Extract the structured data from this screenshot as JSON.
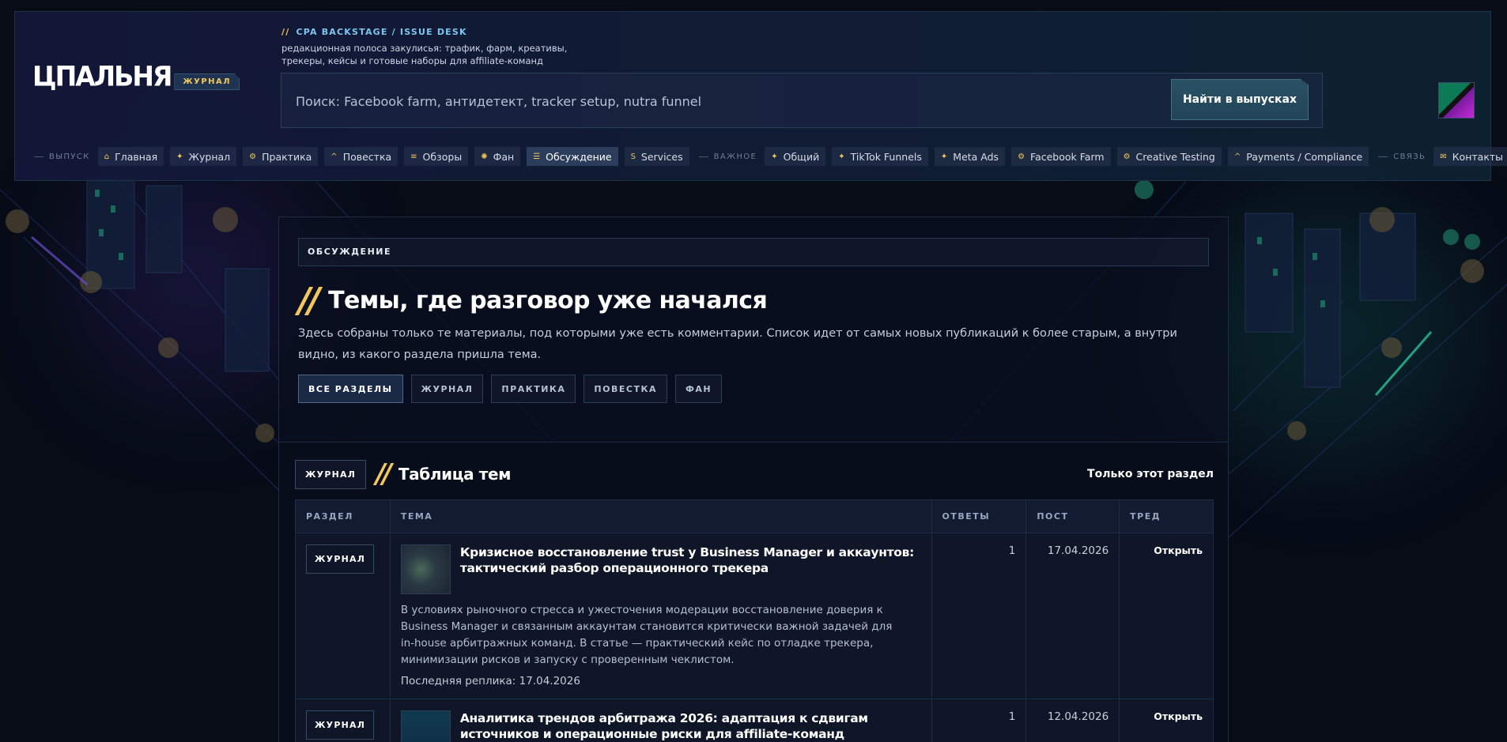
{
  "brand": {
    "logo": "ЦПАЛЬНЯ",
    "badge": "ЖУРНАЛ"
  },
  "header": {
    "kicker_slash": "//",
    "kicker": "CPA BACKSTAGE / ISSUE DESK",
    "tagline": "редакционная полоса закулисья: трафик, фарм, креативы, трекеры, кейсы и готовые наборы для affiliate-команд"
  },
  "search": {
    "placeholder": "Поиск: Facebook farm, антидетект, tracker setup, nutra funnel",
    "button": "Найти в выпусках"
  },
  "nav": {
    "group_issue": "ВЫПУСК",
    "group_important": "ВАЖНОЕ",
    "group_contact": "СВЯЗЬ",
    "items": [
      {
        "label": "Главная",
        "icon": "⌂"
      },
      {
        "label": "Журнал",
        "icon": "✦"
      },
      {
        "label": "Практика",
        "icon": "⚙"
      },
      {
        "label": "Повестка",
        "icon": "^"
      },
      {
        "label": "Обзоры",
        "icon": "≡"
      },
      {
        "label": "Фан",
        "icon": "✺"
      },
      {
        "label": "Обсуждение",
        "icon": "☰"
      },
      {
        "label": "Services",
        "icon": "S"
      },
      {
        "label": "Общий",
        "icon": "✦"
      },
      {
        "label": "TikTok Funnels",
        "icon": "✦"
      },
      {
        "label": "Meta Ads",
        "icon": "✦"
      },
      {
        "label": "Facebook Farm",
        "icon": "⚙"
      },
      {
        "label": "Creative Testing",
        "icon": "⚙"
      },
      {
        "label": "Payments / Compliance",
        "icon": "^"
      },
      {
        "label": "Контакты",
        "icon": "✉"
      }
    ]
  },
  "discussion": {
    "section_label": "ОБСУЖДЕНИЕ",
    "slash": "//",
    "title": "Темы, где разговор уже начался",
    "lead": "Здесь собраны только те материалы, под которыми уже есть комментарии. Список идет от самых новых публикаций к более старым, а внутри видно, из какого раздела пришла тема.",
    "filters": [
      "ВСЕ РАЗДЕЛЫ",
      "ЖУРНАЛ",
      "ПРАКТИКА",
      "ПОВЕСТКА",
      "ФАН"
    ]
  },
  "table_section": {
    "tag": "ЖУРНАЛ",
    "slash": "//",
    "title": "Таблица тем",
    "only_link": "Только этот раздел",
    "headers": [
      "РАЗДЕЛ",
      "ТЕМА",
      "ОТВЕТЫ",
      "ПОСТ",
      "ТРЕД"
    ],
    "rows": [
      {
        "section": "ЖУРНАЛ",
        "title": "Кризисное восстановление trust у Business Manager и аккаунтов: тактический разбор операционного трекера",
        "excerpt": "В условиях рыночного стресса и ужесточения модерации восстановление доверия к Business Manager и связанным аккаунтам становится критически важной задачей для in-house арбитражных команд. В статье — практический кейс по отладке трекера, минимизации рисков и запуску с проверенным чеклистом.",
        "last_reply": "Последняя реплика: 17.04.2026",
        "replies": "1",
        "posted": "17.04.2026",
        "open": "Открыть"
      },
      {
        "section": "ЖУРНАЛ",
        "title": "Аналитика трендов арбитража 2026: адаптация к сдвигам источников и операционные риски для affiliate-команд",
        "replies": "1",
        "posted": "12.04.2026",
        "open": "Открыть"
      }
    ]
  },
  "colors": {
    "accent": "#f2c75c",
    "link": "#7cc6f0",
    "bg": "#070c17"
  }
}
